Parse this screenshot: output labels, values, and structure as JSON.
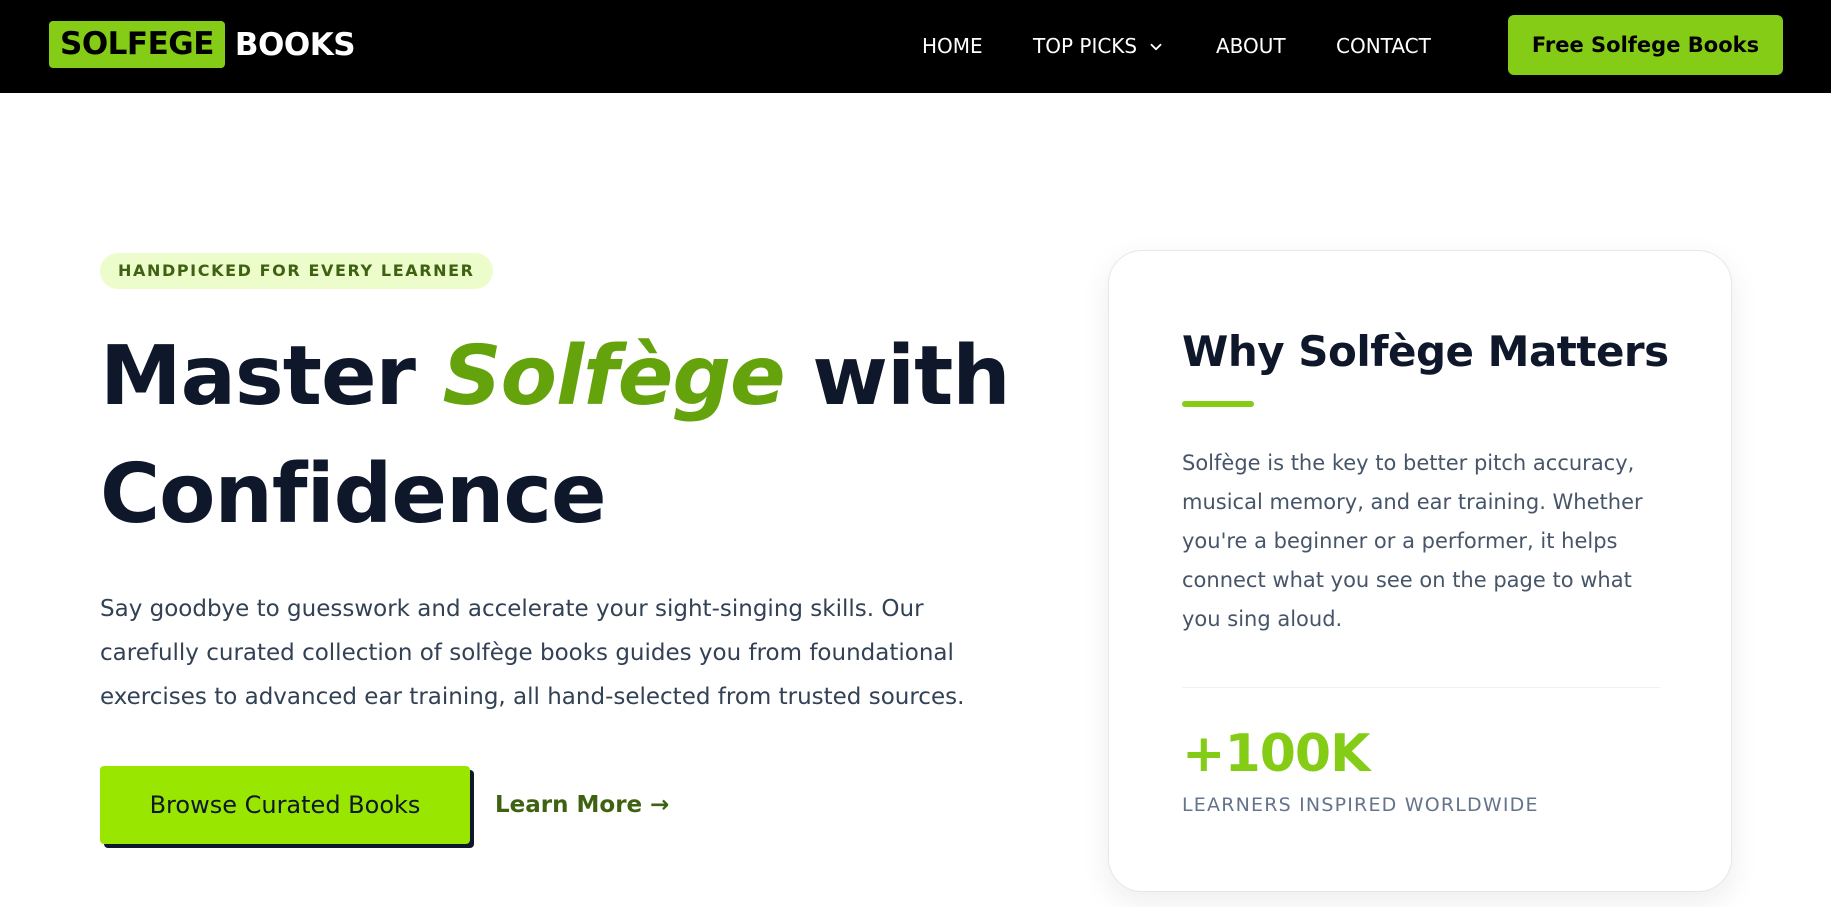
{
  "header": {
    "logo": {
      "box_text": "SOLFEGE",
      "text": "BOOKS"
    },
    "nav": [
      {
        "label": "HOME"
      },
      {
        "label": "TOP PICKS",
        "icon": "chevron-down-icon"
      },
      {
        "label": "ABOUT"
      },
      {
        "label": "CONTACT"
      }
    ],
    "cta_label": "Free Solfege Books"
  },
  "hero": {
    "badge": "HANDPICKED FOR EVERY LEARNER",
    "headline": {
      "before": "Master ",
      "accent": "Solfège",
      "after": " with",
      "line2": "Confidence"
    },
    "lead": "Say goodbye to guesswork and accelerate your sight-singing skills. Our carefully curated collection of solfège books guides you from foundational exercises to advanced ear training, all hand-selected from trusted sources.",
    "primary_button": "Browse Curated Books",
    "secondary_link": "Learn More →"
  },
  "card": {
    "title": "Why Solfège Matters",
    "body": "Solfège is the key to better pitch accuracy, musical memory, and ear training. Whether you're a beginner or a performer, it helps connect what you see on the page to what you sing aloud.",
    "stat_value": "+100K",
    "stat_label": "LEARNERS INSPIRED WORLDWIDE"
  },
  "colors": {
    "accent": "#84cc16",
    "accent_dark": "#65a30d",
    "header_bg": "#000000",
    "heading": "#0f172a"
  }
}
